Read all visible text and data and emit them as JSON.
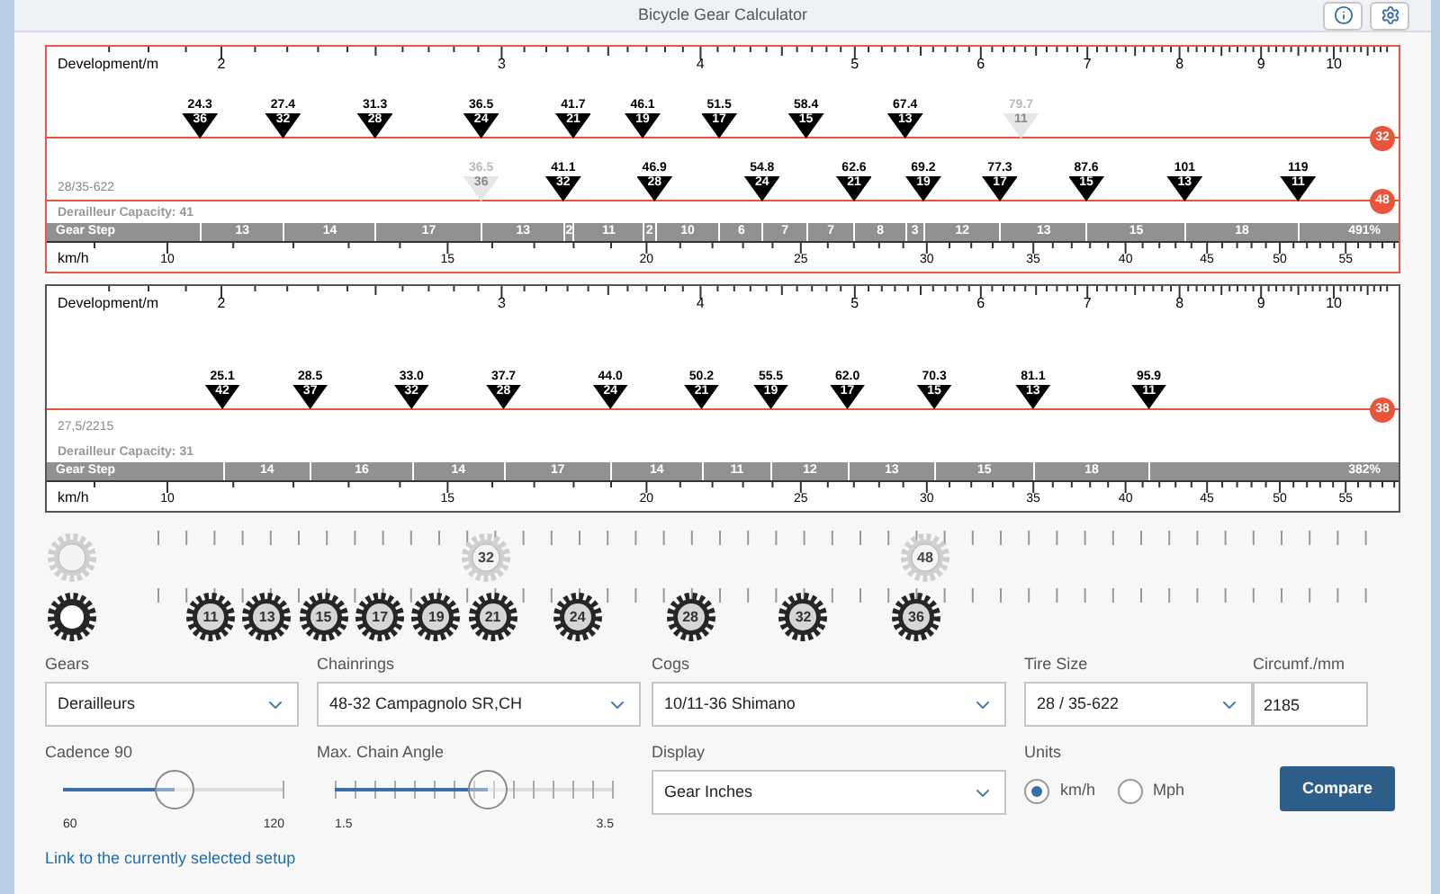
{
  "header": {
    "title": "Bicycle Gear Calculator"
  },
  "charts": [
    {
      "selected": true,
      "axis_top": {
        "label": "Development/m",
        "ticks": [
          "2",
          "3",
          "4",
          "5",
          "6",
          "7",
          "8",
          "9",
          "10"
        ]
      },
      "rows": [
        {
          "chainring": "32",
          "markers": [
            {
              "value": "24.3",
              "cog": "36",
              "disabled": false
            },
            {
              "value": "27.4",
              "cog": "32",
              "disabled": false
            },
            {
              "value": "31.3",
              "cog": "28",
              "disabled": false
            },
            {
              "value": "36.5",
              "cog": "24",
              "disabled": false
            },
            {
              "value": "41.7",
              "cog": "21",
              "disabled": false
            },
            {
              "value": "46.1",
              "cog": "19",
              "disabled": false
            },
            {
              "value": "51.5",
              "cog": "17",
              "disabled": false
            },
            {
              "value": "58.4",
              "cog": "15",
              "disabled": false
            },
            {
              "value": "67.4",
              "cog": "13",
              "disabled": false
            },
            {
              "value": "79.7",
              "cog": "11",
              "disabled": true
            }
          ]
        },
        {
          "chainring": "48",
          "markers": [
            {
              "value": "36.5",
              "cog": "36",
              "disabled": true
            },
            {
              "value": "41.1",
              "cog": "32",
              "disabled": false
            },
            {
              "value": "46.9",
              "cog": "28",
              "disabled": false
            },
            {
              "value": "54.8",
              "cog": "24",
              "disabled": false
            },
            {
              "value": "62.6",
              "cog": "21",
              "disabled": false
            },
            {
              "value": "69.2",
              "cog": "19",
              "disabled": false
            },
            {
              "value": "77.3",
              "cog": "17",
              "disabled": false
            },
            {
              "value": "87.6",
              "cog": "15",
              "disabled": false
            },
            {
              "value": "101",
              "cog": "13",
              "disabled": false
            },
            {
              "value": "119",
              "cog": "11",
              "disabled": false
            }
          ]
        }
      ],
      "tire": "28/35-622",
      "capacity": "Derailleur Capacity: 41",
      "gear_step": {
        "label": "Gear Step",
        "steps": [
          "13",
          "14",
          "17",
          "13",
          "2",
          "11",
          "2",
          "10",
          "6",
          "7",
          "7",
          "8",
          "3",
          "12",
          "13",
          "15",
          "18"
        ],
        "total": "491%"
      },
      "axis_bottom": {
        "label": "km/h",
        "ticks": [
          "10",
          "15",
          "20",
          "25",
          "30",
          "35",
          "40",
          "45",
          "50",
          "55"
        ]
      }
    },
    {
      "selected": false,
      "axis_top": {
        "label": "Development/m",
        "ticks": [
          "2",
          "3",
          "4",
          "5",
          "6",
          "7",
          "8",
          "9",
          "10"
        ]
      },
      "rows": [
        {
          "chainring": "38",
          "markers": [
            {
              "value": "25.1",
              "cog": "42",
              "disabled": false
            },
            {
              "value": "28.5",
              "cog": "37",
              "disabled": false
            },
            {
              "value": "33.0",
              "cog": "32",
              "disabled": false
            },
            {
              "value": "37.7",
              "cog": "28",
              "disabled": false
            },
            {
              "value": "44.0",
              "cog": "24",
              "disabled": false
            },
            {
              "value": "50.2",
              "cog": "21",
              "disabled": false
            },
            {
              "value": "55.5",
              "cog": "19",
              "disabled": false
            },
            {
              "value": "62.0",
              "cog": "17",
              "disabled": false
            },
            {
              "value": "70.3",
              "cog": "15",
              "disabled": false
            },
            {
              "value": "81.1",
              "cog": "13",
              "disabled": false
            },
            {
              "value": "95.9",
              "cog": "11",
              "disabled": false
            }
          ]
        }
      ],
      "tire": "27,5/2215",
      "capacity": "Derailleur Capacity: 31",
      "gear_step": {
        "label": "Gear Step",
        "steps": [
          "14",
          "16",
          "14",
          "17",
          "14",
          "11",
          "12",
          "13",
          "15",
          "18"
        ],
        "total": "382%"
      },
      "axis_bottom": {
        "label": "km/h",
        "ticks": [
          "10",
          "15",
          "20",
          "25",
          "30",
          "35",
          "40",
          "45",
          "50",
          "55"
        ]
      }
    }
  ],
  "gear_strip": {
    "chainrings": [
      "32",
      "48"
    ],
    "cogs": [
      "11",
      "13",
      "15",
      "17",
      "19",
      "21",
      "24",
      "28",
      "32",
      "36"
    ]
  },
  "controls": {
    "gears": {
      "label": "Gears",
      "value": "Derailleurs"
    },
    "chainrings": {
      "label": "Chainrings",
      "value": "48-32 Campagnolo SR,CH"
    },
    "cogs": {
      "label": "Cogs",
      "value": "10/11-36 Shimano"
    },
    "tire_size": {
      "label": "Tire Size",
      "value": "28 / 35-622"
    },
    "circumference": {
      "label": "Circumf./mm",
      "value": "2185"
    },
    "cadence": {
      "label": "Cadence 90",
      "kind": "plain",
      "level": 0.5,
      "min": "60",
      "max": "120"
    },
    "chain_angle": {
      "label": "Max. Chain Angle",
      "kind": "ticked",
      "level": 0.55,
      "min": "1.5",
      "max": "3.5"
    },
    "display": {
      "label": "Display",
      "value": "Gear Inches"
    },
    "units": {
      "label": "Units",
      "options": [
        {
          "label": "km/h",
          "selected": true
        },
        {
          "label": "Mph",
          "selected": false
        }
      ]
    },
    "compare": "Compare",
    "link": "Link to the currently selected setup"
  }
}
